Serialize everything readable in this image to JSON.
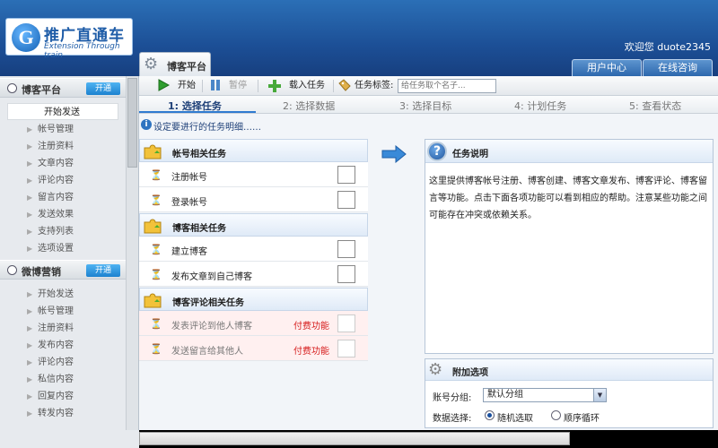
{
  "header": {
    "logo_cn": "推广直通车",
    "logo_en": "Extension Through train",
    "welcome": "欢迎您 duote2345",
    "user_center": "用户中心",
    "online_consult": "在线咨询"
  },
  "sidebar": {
    "groups": [
      {
        "title": "博客平台",
        "badge": "开通",
        "items": [
          "开始发送",
          "帐号管理",
          "注册资料",
          "文章内容",
          "评论内容",
          "留言内容",
          "发送效果",
          "支持列表",
          "选项设置"
        ]
      },
      {
        "title": "微博营销",
        "badge": "开通",
        "items": [
          "开始发送",
          "帐号管理",
          "注册资料",
          "发布内容",
          "评论内容",
          "私信内容",
          "回复内容",
          "转发内容"
        ]
      }
    ]
  },
  "tab": {
    "label": "博客平台"
  },
  "toolbar": {
    "start": "开始",
    "pause": "暂停",
    "load_task": "载入任务",
    "task_tag_label": "任务标签:",
    "task_tag_placeholder": "给任务取个名子..."
  },
  "steps": [
    "1: 选择任务",
    "2: 选择数据",
    "3: 选择目标",
    "4: 计划任务",
    "5: 查看状态"
  ],
  "hint": "设定要进行的任务明细……",
  "tasks": {
    "cat1": "帐号相关任务",
    "cat1_items": [
      "注册帐号",
      "登录帐号"
    ],
    "cat2": "博客相关任务",
    "cat2_items": [
      "建立博客",
      "发布文章到自己博客"
    ],
    "cat3": "博客评论相关任务",
    "cat3_items": [
      "发表评论到他人博客",
      "发送留言给其他人"
    ],
    "paid_label": "付费功能"
  },
  "info": {
    "title": "任务说明",
    "body": "这里提供博客帐号注册、博客创建、博客文章发布、博客评论、博客留言等功能。点击下面各项功能可以看到相应的帮助。注意某些功能之间可能存在冲突或依赖关系。"
  },
  "extra": {
    "title": "附加选项",
    "group_label": "账号分组:",
    "group_value": "默认分组",
    "data_label": "数据选择:",
    "opt_random": "随机选取",
    "opt_order": "顺序循环"
  }
}
